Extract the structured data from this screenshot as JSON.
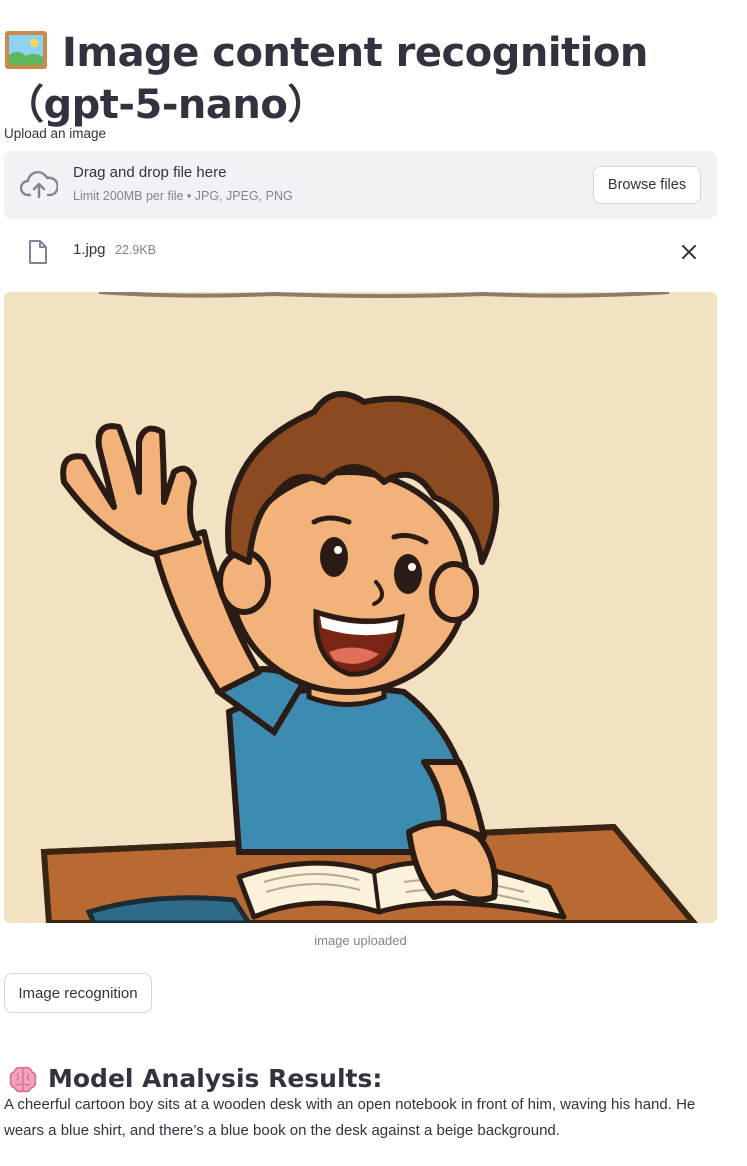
{
  "page": {
    "title": "Image content recognition（gpt-5-nano）",
    "title_icon": "framed-picture-icon"
  },
  "uploader": {
    "label": "Upload an image",
    "dropzone_text": "Drag and drop file here",
    "limit_text": "Limit 200MB per file • JPG, JPEG, PNG",
    "browse_label": "Browse files",
    "upload_icon": "cloud-upload-icon"
  },
  "uploaded_file": {
    "name": "1.jpg",
    "size": "22.9KB",
    "file_icon": "file-icon",
    "remove_icon": "close-icon"
  },
  "image": {
    "caption": "image uploaded",
    "subject": "cartoon boy waving at desk"
  },
  "actions": {
    "recognize_label": "Image recognition"
  },
  "results": {
    "heading": "Model Analysis Results:",
    "heading_icon": "brain-icon",
    "text": "A cheerful cartoon boy sits at a wooden desk with an open notebook in front of him, waving his hand. He wears a blue shirt, and there’s a blue book on the desk against a beige background."
  },
  "colors": {
    "text": "#31333f",
    "muted": "#808495",
    "dropzone_bg": "#f0f2f6",
    "image_bg": "#f3e2c1"
  }
}
